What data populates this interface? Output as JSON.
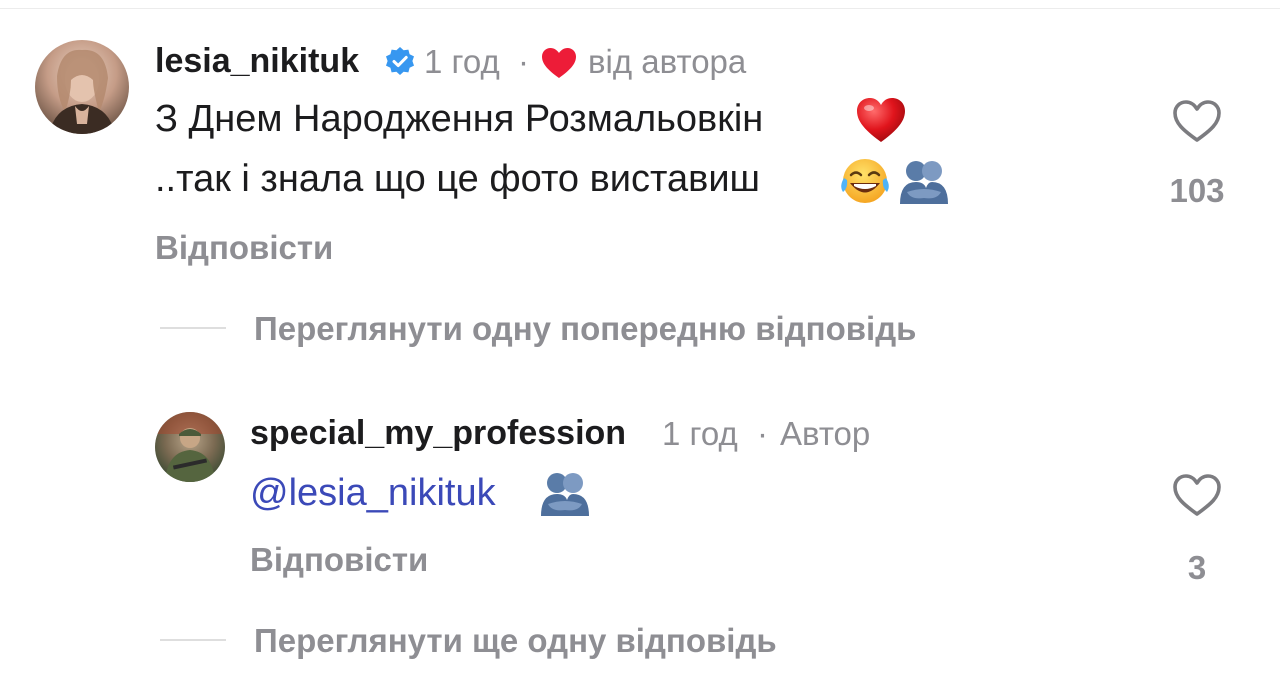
{
  "comment": {
    "username": "lesia_nikituk",
    "time": "1 год",
    "separator": "·",
    "liked_by_author": "від автора",
    "text_line_1": "З Днем Народження Розмальовкін",
    "text_line_2": "..так і знала що це фото виставиш",
    "reply_label": "Відповісти",
    "like_count": "103",
    "view_replies_label": "Переглянути одну попередню відповідь",
    "icons": {
      "verified": "verified-badge-icon",
      "author_like": "red-heart-icon",
      "like": "heart-outline-icon"
    }
  },
  "reply": {
    "username": "special_my_profession",
    "time": "1 год",
    "separator": "·",
    "author_label": "Автор",
    "mention": "@lesia_nikituk",
    "reply_label": "Відповісти",
    "like_count": "3",
    "view_replies_label": "Переглянути ще одну відповідь",
    "icons": {
      "like": "heart-outline-icon"
    }
  },
  "colors": {
    "text": "#1c1c1e",
    "muted": "#8e8e93",
    "mention": "#3b49b8",
    "verified": "#3797f0",
    "author_heart": "#ed1c38"
  }
}
